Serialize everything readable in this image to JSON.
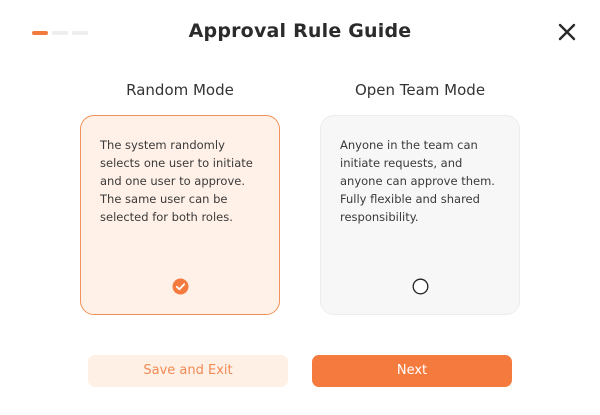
{
  "dialog": {
    "title": "Approval Rule Guide",
    "close_icon": "close-icon",
    "steps": {
      "total": 3,
      "current": 1
    }
  },
  "modes": [
    {
      "label": "Random Mode",
      "description": "The system randomly selects one user to initiate and one user to approve. The same user can be selected for both roles.",
      "selected": true
    },
    {
      "label": "Open Team Mode",
      "description": "Anyone in the team can initiate requests, and anyone can approve them. Fully flexible and shared responsibility.",
      "selected": false
    }
  ],
  "buttons": {
    "secondary_label": "Save and Exit",
    "primary_label": "Next"
  },
  "colors": {
    "accent": "#f47a3e",
    "selected_card_bg": "#fff1e8",
    "unselected_card_bg": "#f7f7f7"
  }
}
